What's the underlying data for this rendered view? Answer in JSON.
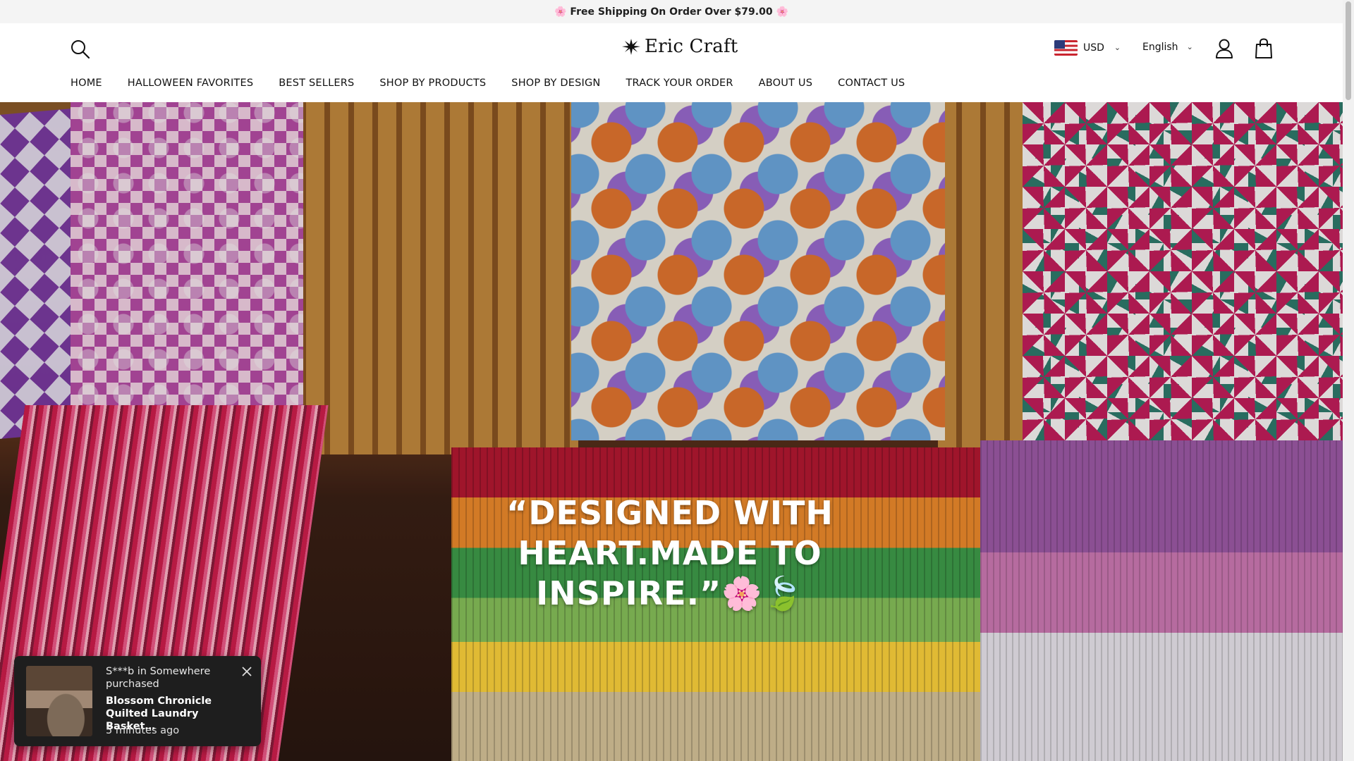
{
  "announcement": {
    "text": "🌸 Free Shipping On Order Over $79.00 🌸"
  },
  "header": {
    "brand": "Eric Craft",
    "currency": {
      "code": "USD",
      "flag": "us-flag-icon"
    },
    "language": "English",
    "icons": [
      "search-icon",
      "eric-craft-logo-icon",
      "chevron-down-icon",
      "user-icon",
      "shopping-bag-icon"
    ]
  },
  "nav": {
    "items": [
      {
        "label": "HOME"
      },
      {
        "label": "HALLOWEEN FAVORITES"
      },
      {
        "label": "BEST SELLERS"
      },
      {
        "label": "SHOP BY PRODUCTS"
      },
      {
        "label": "SHOP BY DESIGN"
      },
      {
        "label": "TRACK YOUR ORDER"
      },
      {
        "label": "ABOUT US"
      },
      {
        "label": "CONTACT US"
      }
    ]
  },
  "hero": {
    "title": "“DESIGNED WITH HEART.MADE TO INSPIRE.”🌸🍃"
  },
  "popup": {
    "line1": "S***b in Somewhere purchased",
    "product": "Blossom Chronicle Quilted Laundry Basket…",
    "time": "5 minutes ago"
  },
  "colors": {
    "announcement_bg": "#f4f4f4",
    "popup_bg": "#1e1e1e",
    "text": "#111111"
  }
}
